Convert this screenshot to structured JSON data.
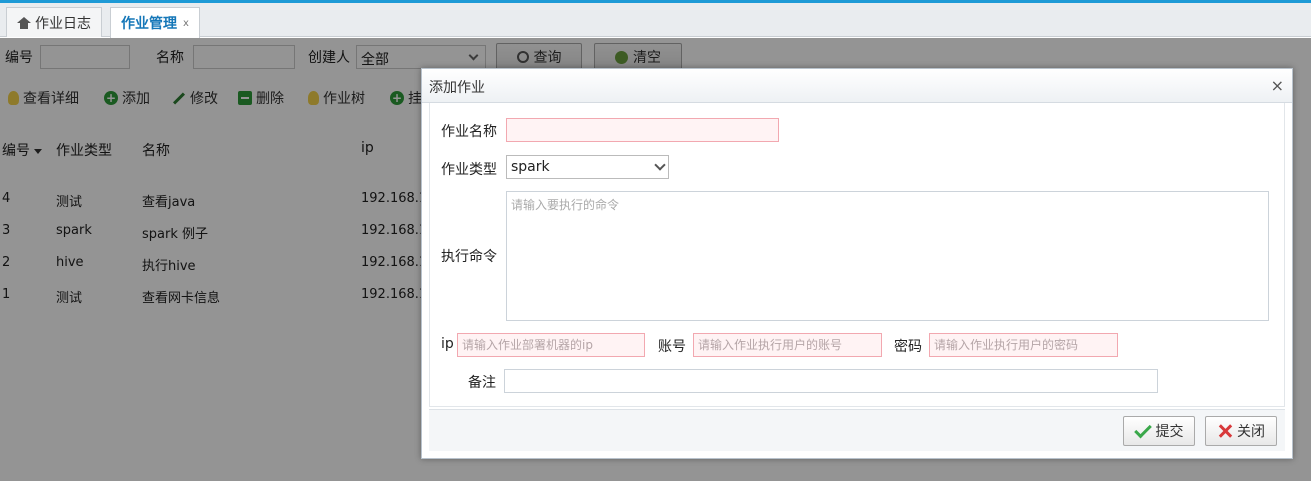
{
  "tabs": [
    {
      "label": "作业日志",
      "icon": "home-icon"
    },
    {
      "label": "作业管理",
      "close": "x"
    }
  ],
  "search": {
    "id_label": "编号",
    "name_label": "名称",
    "creator_label": "创建人",
    "creator_value": "全部",
    "query_button": "查询",
    "clear_button": "清空"
  },
  "toolbar": {
    "detail": "查看详细",
    "add": "添加",
    "edit": "修改",
    "delete": "删除",
    "tree": "作业树",
    "partial": "挂"
  },
  "table": {
    "columns": [
      "编号",
      "作业类型",
      "名称",
      "ip"
    ],
    "rows": [
      {
        "id": "4",
        "type": "测试",
        "name": "查看java",
        "ip": "192.168.1"
      },
      {
        "id": "3",
        "type": "spark",
        "name": "spark 例子",
        "ip": "192.168.1"
      },
      {
        "id": "2",
        "type": "hive",
        "name": "执行hive",
        "ip": "192.168.1"
      },
      {
        "id": "1",
        "type": "测试",
        "name": "查看网卡信息",
        "ip": "192.168.1"
      }
    ]
  },
  "dialog": {
    "title": "添加作业",
    "close_glyph": "×",
    "job_name_label": "作业名称",
    "job_type_label": "作业类型",
    "job_type_value": "spark",
    "command_label": "执行命令",
    "command_placeholder": "请输入要执行的命令",
    "ip_label": "ip",
    "ip_placeholder": "请输入作业部署机器的ip",
    "account_label": "账号",
    "account_placeholder": "请输入作业执行用户的账号",
    "password_label": "密码",
    "password_placeholder": "请输入作业执行用户的密码",
    "remark_label": "备注",
    "submit_button": "提交",
    "close_button": "关闭"
  },
  "colors": {
    "accent": "#1e9ad6",
    "active_tab_text": "#1577b8",
    "required_border": "#f2a8b0"
  }
}
